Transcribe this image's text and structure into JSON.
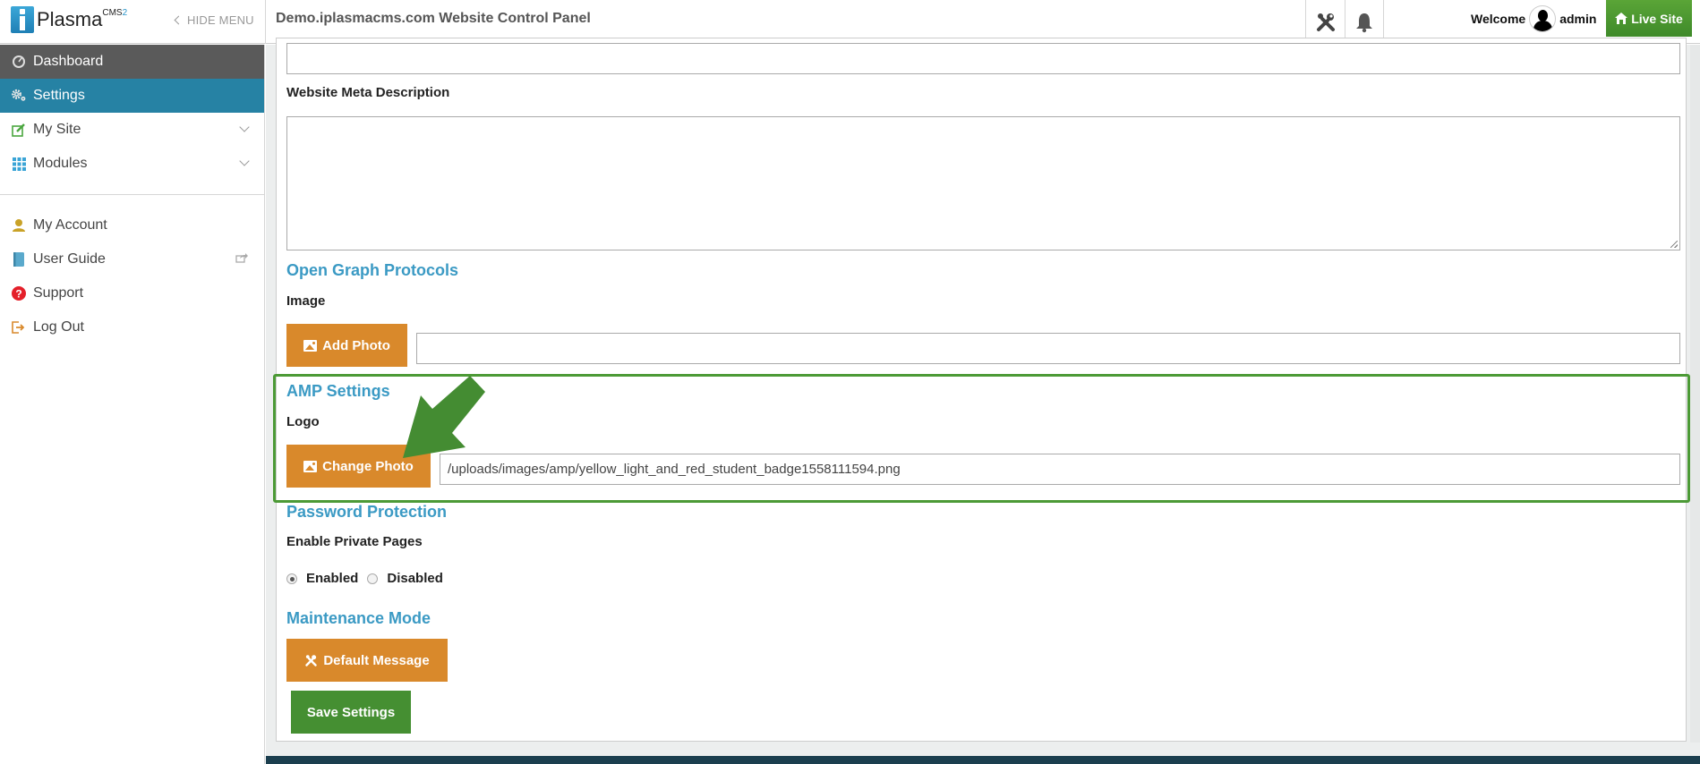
{
  "header": {
    "brand_name": "Plasma",
    "brand_sup": "CMS",
    "brand_sup_version": "2",
    "hide_menu_label": "HIDE MENU",
    "page_title": "Demo.iplasmacms.com Website Control Panel",
    "welcome_label": "Welcome",
    "username": "admin",
    "live_site_label": "Live Site",
    "icons": [
      "tools-icon",
      "bell-icon"
    ]
  },
  "sidebar": {
    "items": [
      {
        "label": "Dashboard",
        "icon": "dashboard-icon"
      },
      {
        "label": "Settings",
        "icon": "gears-icon"
      },
      {
        "label": "My Site",
        "icon": "edit-icon"
      },
      {
        "label": "Modules",
        "icon": "grid-icon"
      },
      {
        "label": "My Account",
        "icon": "user-icon"
      },
      {
        "label": "User Guide",
        "icon": "book-icon"
      },
      {
        "label": "Support",
        "icon": "question-icon"
      },
      {
        "label": "Log Out",
        "icon": "logout-icon"
      }
    ],
    "active": "Settings"
  },
  "form": {
    "top_input_value": "",
    "meta_description_label": "Website Meta Description",
    "meta_description_value": "",
    "open_graph": {
      "title": "Open Graph Protocols",
      "image_label": "Image",
      "add_photo_label": "Add Photo",
      "image_path": ""
    },
    "amp": {
      "title": "AMP Settings",
      "logo_label": "Logo",
      "change_photo_label": "Change Photo",
      "logo_path": "/uploads/images/amp/yellow_light_and_red_student_badge1558111594.png"
    },
    "password_protection": {
      "title": "Password Protection",
      "private_pages_label": "Enable Private Pages",
      "options": [
        "Enabled",
        "Disabled"
      ],
      "selected": "Enabled"
    },
    "maintenance": {
      "title": "Maintenance Mode",
      "default_message_label": "Default Message"
    },
    "save_label": "Save Settings"
  },
  "colors": {
    "accent_blue": "#2682a4",
    "section_title": "#3b9ac4",
    "orange_button": "#d9892b",
    "green_button": "#458f32",
    "highlight_box": "#4c9a36"
  }
}
